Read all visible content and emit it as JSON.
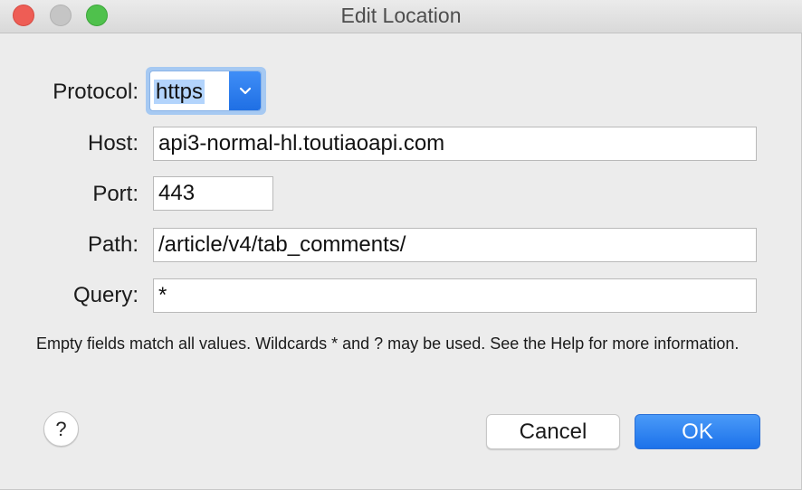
{
  "window": {
    "title": "Edit Location"
  },
  "form": {
    "protocol": {
      "label": "Protocol:",
      "value": "https"
    },
    "host": {
      "label": "Host:",
      "value": "api3-normal-hl.toutiaoapi.com"
    },
    "port": {
      "label": "Port:",
      "value": "443"
    },
    "path": {
      "label": "Path:",
      "value": "/article/v4/tab_comments/"
    },
    "query": {
      "label": "Query:",
      "value": "*"
    }
  },
  "info_text": "Empty fields match all values. Wildcards * and ? may be used. See the Help for more information.",
  "buttons": {
    "help": "?",
    "cancel": "Cancel",
    "ok": "OK"
  },
  "colors": {
    "accent": "#1f6fe4",
    "close": "#ee5d55",
    "minimize_disabled": "#c5c5c5",
    "zoom": "#4fc14c",
    "background": "#ececec"
  },
  "icons": {
    "protocol_dropdown": "chevron-down-icon"
  }
}
